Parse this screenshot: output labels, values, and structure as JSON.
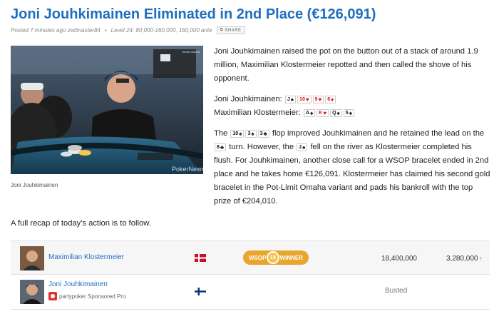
{
  "post": {
    "title": "Joni Jouhkimainen Eliminated in 2nd Place (€126,091)",
    "meta_posted": "Posted 7 minutes ago zedmaster84",
    "meta_level": "Level 24: 80,000-160,000, 160,000 ante",
    "share_label": "SHARE",
    "photo_credit": "Tomas Stacha",
    "photo_watermark": "PokerNews",
    "caption": "Joni Jouhkimainen"
  },
  "article": {
    "p1": "Joni Jouhkimainen raised the pot on the button out of a stack of around 1.9 million, Maximilian Klostermeier repotted and then called the shove of his opponent.",
    "hand1_name": "Joni Jouhkimainen:",
    "hand1_cards": [
      {
        "rank": "J",
        "suit": "♠",
        "color": "blk"
      },
      {
        "rank": "10",
        "suit": "♥",
        "color": "red"
      },
      {
        "rank": "9",
        "suit": "♥",
        "color": "red"
      },
      {
        "rank": "6",
        "suit": "♦",
        "color": "red"
      }
    ],
    "hand2_name": "Maximilian Klostermeier:",
    "hand2_cards": [
      {
        "rank": "A",
        "suit": "♠",
        "color": "blk"
      },
      {
        "rank": "K",
        "suit": "♥",
        "color": "red"
      },
      {
        "rank": "Q",
        "suit": "♠",
        "color": "blk"
      },
      {
        "rank": "5",
        "suit": "♠",
        "color": "blk"
      }
    ],
    "p3_a": "The",
    "flop_cards": [
      {
        "rank": "10",
        "suit": "♠",
        "color": "blk"
      },
      {
        "rank": "3",
        "suit": "♠",
        "color": "blk"
      },
      {
        "rank": "3",
        "suit": "♣",
        "color": "blk"
      }
    ],
    "p3_b": "flop improved Jouhkimainen and he retained the lead on the",
    "turn_card": {
      "rank": "8",
      "suit": "♣",
      "color": "blk"
    },
    "p3_c": "turn. However, the",
    "river_card": {
      "rank": "J",
      "suit": "♠",
      "color": "blk"
    },
    "p3_d": "fell on the river as Klostermeier completed his flush. For Jouhkimainen, another close call for a WSOP bracelet ended in 2nd place and he takes home €126,091. Klostermeier has claimed his second gold bracelet in the Pot-Limit Omaha variant and pads his bankroll with the top prize of €204,010.",
    "recap": "A full recap of today's action is to follow."
  },
  "players": [
    {
      "name": "Maximilian Klostermeier",
      "country": "Denmark",
      "badge_left": "WSOP",
      "badge_mid": "1X",
      "badge_right": "WINNER",
      "chips": "18,400,000",
      "change": "3,280,000"
    },
    {
      "name": "Joni Jouhkimainen",
      "sponsor": "partypoker Sponsored Pro",
      "country": "Finland",
      "status": "Busted"
    }
  ],
  "colors": {
    "link": "#1f6fbf",
    "badge": "#e8a62c",
    "up": "#2a9d3b"
  }
}
